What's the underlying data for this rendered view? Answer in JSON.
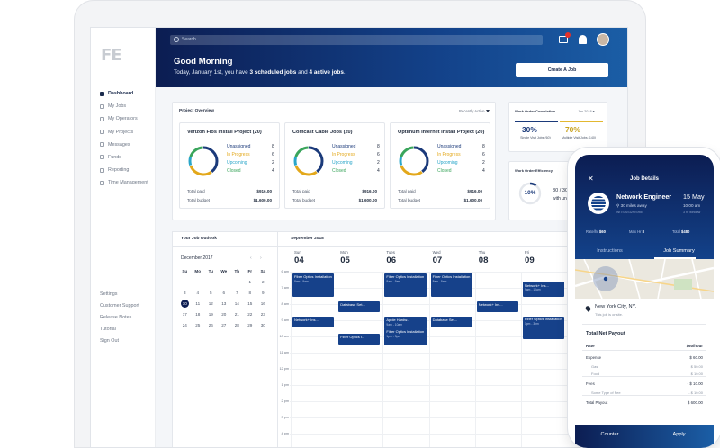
{
  "logo": "FE",
  "sidebar": {
    "items": [
      {
        "label": "Dashboard"
      },
      {
        "label": "My Jobs"
      },
      {
        "label": "My Operators"
      },
      {
        "label": "My Projects"
      },
      {
        "label": "Messages"
      },
      {
        "label": "Funds"
      },
      {
        "label": "Reporting"
      },
      {
        "label": "Time Management"
      }
    ],
    "bottom": [
      "Settings",
      "Customer Support",
      "Release Notes",
      "Tutorial",
      "Sign Out"
    ]
  },
  "header": {
    "search_placeholder": "Search",
    "greeting": "Good Morning",
    "sub_pre": "Today, January 1st, you have ",
    "sub_jobs": "3 scheduled jobs",
    "sub_mid": " and ",
    "sub_active": "4 active jobs",
    "sub_end": ".",
    "create_button": "Create A Job"
  },
  "project_overview": {
    "title": "Project Overview",
    "filter": "Recently Active",
    "projects": [
      {
        "title": "Verizon Fios Install Project (20)",
        "unassigned": 8,
        "in_progress": 6,
        "upcoming": 2,
        "closed": 4,
        "total_paid": "$916.00",
        "total_budget": "$1,600.00"
      },
      {
        "title": "Comcast Cable Jobs (20)",
        "unassigned": 8,
        "in_progress": 6,
        "upcoming": 2,
        "closed": 4,
        "total_paid": "$916.00",
        "total_budget": "$1,600.00"
      },
      {
        "title": "Optimum Internet Install Project (20)",
        "unassigned": 8,
        "in_progress": 6,
        "upcoming": 2,
        "closed": 4,
        "total_paid": "$916.00",
        "total_budget": "$1,600.00"
      }
    ],
    "labels": {
      "unassigned": "Unassigned",
      "in_progress": "In Progress",
      "upcoming": "Upcoming",
      "closed": "Closed",
      "total_paid": "Total paid",
      "total_budget": "Total budget"
    }
  },
  "work_order_completion": {
    "title": "Work Order Completion",
    "date": "Jan 2018",
    "single_pct": "30%",
    "single_label": "Single Visit Jobs (60)",
    "multi_pct": "70%",
    "multi_label": "Multiple Visit Jobs (140)"
  },
  "work_order_efficiency": {
    "title": "Work Order Efficiency",
    "pct": "10%",
    "pct_value": 0.1,
    "line1": "30 / 300",
    "line2": "with un"
  },
  "job_outlook": {
    "title": "Your Job Outlook",
    "month": "September 2018",
    "mini_month": "December 2017",
    "dow": [
      "Su",
      "Mo",
      "Tu",
      "We",
      "Th",
      "Fr",
      "Sa"
    ],
    "weeks": [
      [
        "",
        "",
        "",
        "",
        "",
        "1",
        "2"
      ],
      [
        "3",
        "4",
        "5",
        "6",
        "7",
        "8",
        "9"
      ],
      [
        "10",
        "11",
        "12",
        "13",
        "14",
        "15",
        "16"
      ],
      [
        "17",
        "18",
        "19",
        "20",
        "21",
        "22",
        "23"
      ],
      [
        "24",
        "25",
        "26",
        "27",
        "28",
        "29",
        "30"
      ]
    ],
    "today": "10",
    "days": [
      {
        "dow": "Sun",
        "num": "04"
      },
      {
        "dow": "Mon",
        "num": "05"
      },
      {
        "dow": "Tues",
        "num": "06"
      },
      {
        "dow": "Wed",
        "num": "07"
      },
      {
        "dow": "Thu",
        "num": "08"
      },
      {
        "dow": "Fri",
        "num": "09"
      }
    ],
    "hours": [
      "6 am",
      "7 am",
      "8 am",
      "9 am",
      "10 am",
      "11 am",
      "12 pm",
      "1 pm",
      "2 pm",
      "3 pm",
      "4 pm"
    ],
    "events": [
      {
        "day": 0,
        "start": 0,
        "len": 2.4,
        "title": "Fiber Optics Installation",
        "time": "8am - 9am"
      },
      {
        "day": 0,
        "start": 5.3,
        "len": 0.9,
        "title": "Network+ Ins...",
        "time": ""
      },
      {
        "day": 1,
        "start": 3.4,
        "len": 0.9,
        "title": "Database Set...",
        "time": ""
      },
      {
        "day": 1,
        "start": 7.4,
        "len": 0.9,
        "title": "Fiber Optics I...",
        "time": ""
      },
      {
        "day": 2,
        "start": 0,
        "len": 2.4,
        "title": "Fiber Optics Installation",
        "time": "8am - 9am"
      },
      {
        "day": 2,
        "start": 5.3,
        "len": 1.2,
        "title": "Apple Hardw...",
        "time": "9am - 10am"
      },
      {
        "day": 2,
        "start": 6.8,
        "len": 1.6,
        "title": "Fiber Optics Installation",
        "time": "1pm - 3pm"
      },
      {
        "day": 3,
        "start": 0,
        "len": 2.4,
        "title": "Fiber Optics Installation",
        "time": "8am - 9am"
      },
      {
        "day": 3,
        "start": 5.3,
        "len": 0.9,
        "title": "Database Set...",
        "time": ""
      },
      {
        "day": 4,
        "start": 3.4,
        "len": 0.9,
        "title": "Network+ Ins...",
        "time": ""
      },
      {
        "day": 5,
        "start": 1.0,
        "len": 1.4,
        "title": "Network+ Ins...",
        "time": "9am - 10am"
      },
      {
        "day": 5,
        "start": 5.3,
        "len": 2.4,
        "title": "Fiber Optics Installation",
        "time": "1pm - 3pm"
      }
    ]
  },
  "phone": {
    "header": "Job Details",
    "job_title": "Network Engineer",
    "date": "15 May",
    "distance": "30 miles away",
    "time": "10:00 am",
    "job_id": "WI7SISSI2RISRIE",
    "duration": "3 hr window",
    "rates": [
      {
        "label": "Rate/hr",
        "value": "$60"
      },
      {
        "label": "Max Hr",
        "value": "8"
      },
      {
        "label": "Total",
        "value": "$480"
      }
    ],
    "tabs": [
      "Instructions",
      "Job Summary"
    ],
    "address": "New York City, NY.",
    "address_note": "This job is onsite.",
    "payout_title": "Total Net Payout",
    "rows": [
      {
        "label": "Rate",
        "value": "$60/hour",
        "type": "bold"
      },
      {
        "label": "Expense",
        "value": "$ 60.00",
        "type": "main"
      },
      {
        "label": "Gas",
        "value": "$ 50.00",
        "type": "sub"
      },
      {
        "label": "Food",
        "value": "$ 10.00",
        "type": "sub"
      },
      {
        "label": "Fees",
        "value": "- $ 10.00",
        "type": "main"
      },
      {
        "label": "Some Type of Fee",
        "value": "- $ 10.00",
        "type": "sub"
      },
      {
        "label": "Total Payout",
        "value": "$ 600.00",
        "type": "main"
      }
    ],
    "buttons": [
      "Counter",
      "Apply"
    ]
  },
  "colors": {
    "navy": "#0c1d52",
    "blue": "#13428a",
    "unassigned": "#1b3a7a",
    "in_progress": "#e3a81b",
    "upcoming": "#2aa6c9",
    "closed": "#3aa55c"
  }
}
